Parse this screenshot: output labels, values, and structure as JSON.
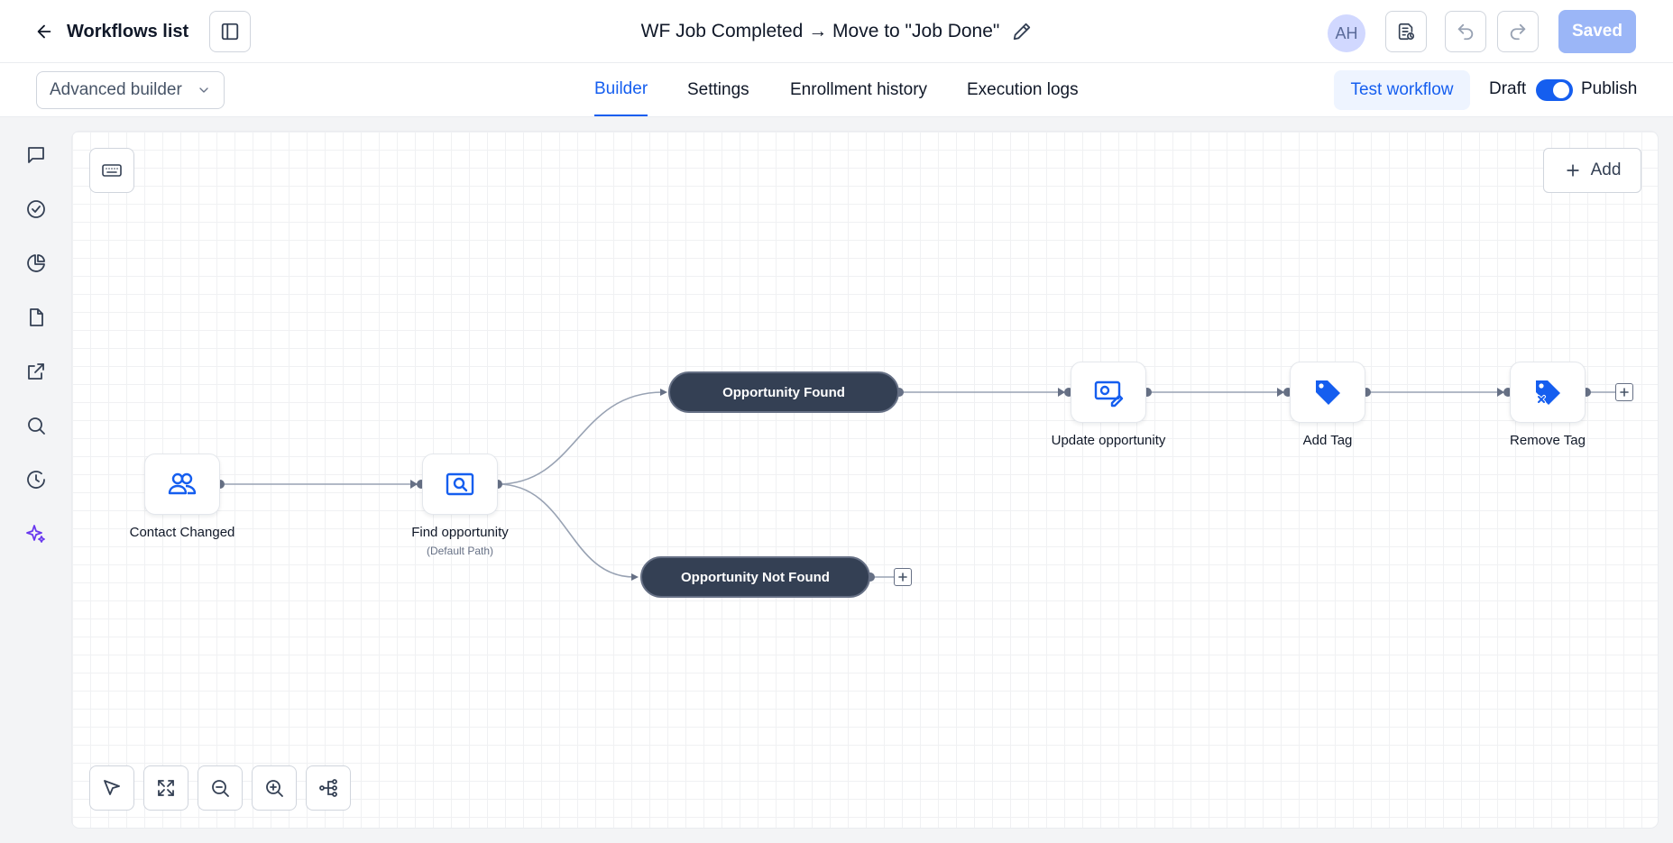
{
  "header": {
    "back_label": "Workflows list",
    "workflow_title": "WF Job Completed → Move to \"Job Done\"",
    "avatar_initials": "AH",
    "saved_label": "Saved"
  },
  "subheader": {
    "builder_select": "Advanced builder",
    "tabs": [
      {
        "label": "Builder",
        "active": true
      },
      {
        "label": "Settings",
        "active": false
      },
      {
        "label": "Enrollment history",
        "active": false
      },
      {
        "label": "Execution logs",
        "active": false
      }
    ],
    "test_workflow_label": "Test workflow",
    "draft_label": "Draft",
    "publish_label": "Publish",
    "publish_toggle_on": true
  },
  "sidebar": {
    "icons": [
      "message-icon",
      "check-circle-icon",
      "pie-chart-icon",
      "document-icon",
      "external-link-icon",
      "search-icon",
      "history-icon",
      "sparkle-icon"
    ]
  },
  "canvas": {
    "add_label": "Add",
    "nodes": {
      "contact_changed": "Contact Changed",
      "find_opportunity": "Find opportunity",
      "find_opportunity_sub": "(Default Path)",
      "update_opportunity": "Update opportunity",
      "add_tag": "Add Tag",
      "remove_tag": "Remove Tag"
    },
    "branches": {
      "found": "Opportunity Found",
      "not_found": "Opportunity Not Found"
    }
  },
  "colors": {
    "accent": "#155eef",
    "pill_bg": "#344054",
    "saved_bg": "#9bb6f7",
    "ai_icon": "#6938ef"
  }
}
